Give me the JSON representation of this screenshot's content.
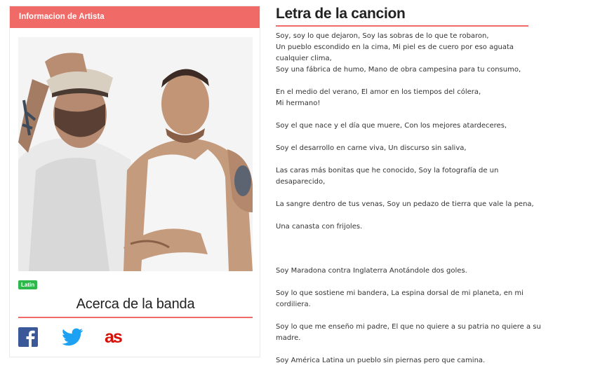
{
  "artist_panel": {
    "header": "Informacion de Artista",
    "genre_badge": "Latin",
    "about_title": "Acerca de la banda"
  },
  "social": {
    "facebook_icon": "facebook-icon",
    "twitter_icon": "twitter-icon",
    "lastfm_icon": "lastfm-icon",
    "facebook_color": "#3b5998",
    "twitter_color": "#1da1f2",
    "lastfm_color": "#d51007"
  },
  "lyrics": {
    "title": "Letra de la cancion",
    "lines": [
      "Soy, soy lo que dejaron, Soy las sobras de lo que te robaron,",
      "Un pueblo escondido en la cima, Mi piel es de cuero por eso aguata",
      "cualquier clima,",
      "Soy una fábrica de humo, Mano de obra campesina para tu consumo,",
      "En el medio del verano, El amor en los tiempos del cólera,",
      "Mi hermano!",
      "Soy el que nace y el día que muere, Con los mejores atardeceres,",
      "Soy el desarrollo en carne viva, Un discurso sin saliva,",
      "Las caras más bonitas que he conocido, Soy la fotografía de un",
      "desaparecido,",
      "La sangre dentro de tus venas, Soy un pedazo de tierra que vale la pena,",
      "Una canasta con frijoles.",
      "Soy Maradona contra Inglaterra Anotándole dos goles.",
      "Soy lo que sostiene mi bandera, La espina dorsal de mi planeta, en mi",
      "cordiliera.",
      "Soy lo que me enseño mi padre, El que no quiere a su patria no quiere a su",
      "madre.",
      "Soy América Latina un pueblo sin piernas pero que camina."
    ]
  },
  "colors": {
    "accent": "#f06b68",
    "badge": "#2db84b"
  }
}
